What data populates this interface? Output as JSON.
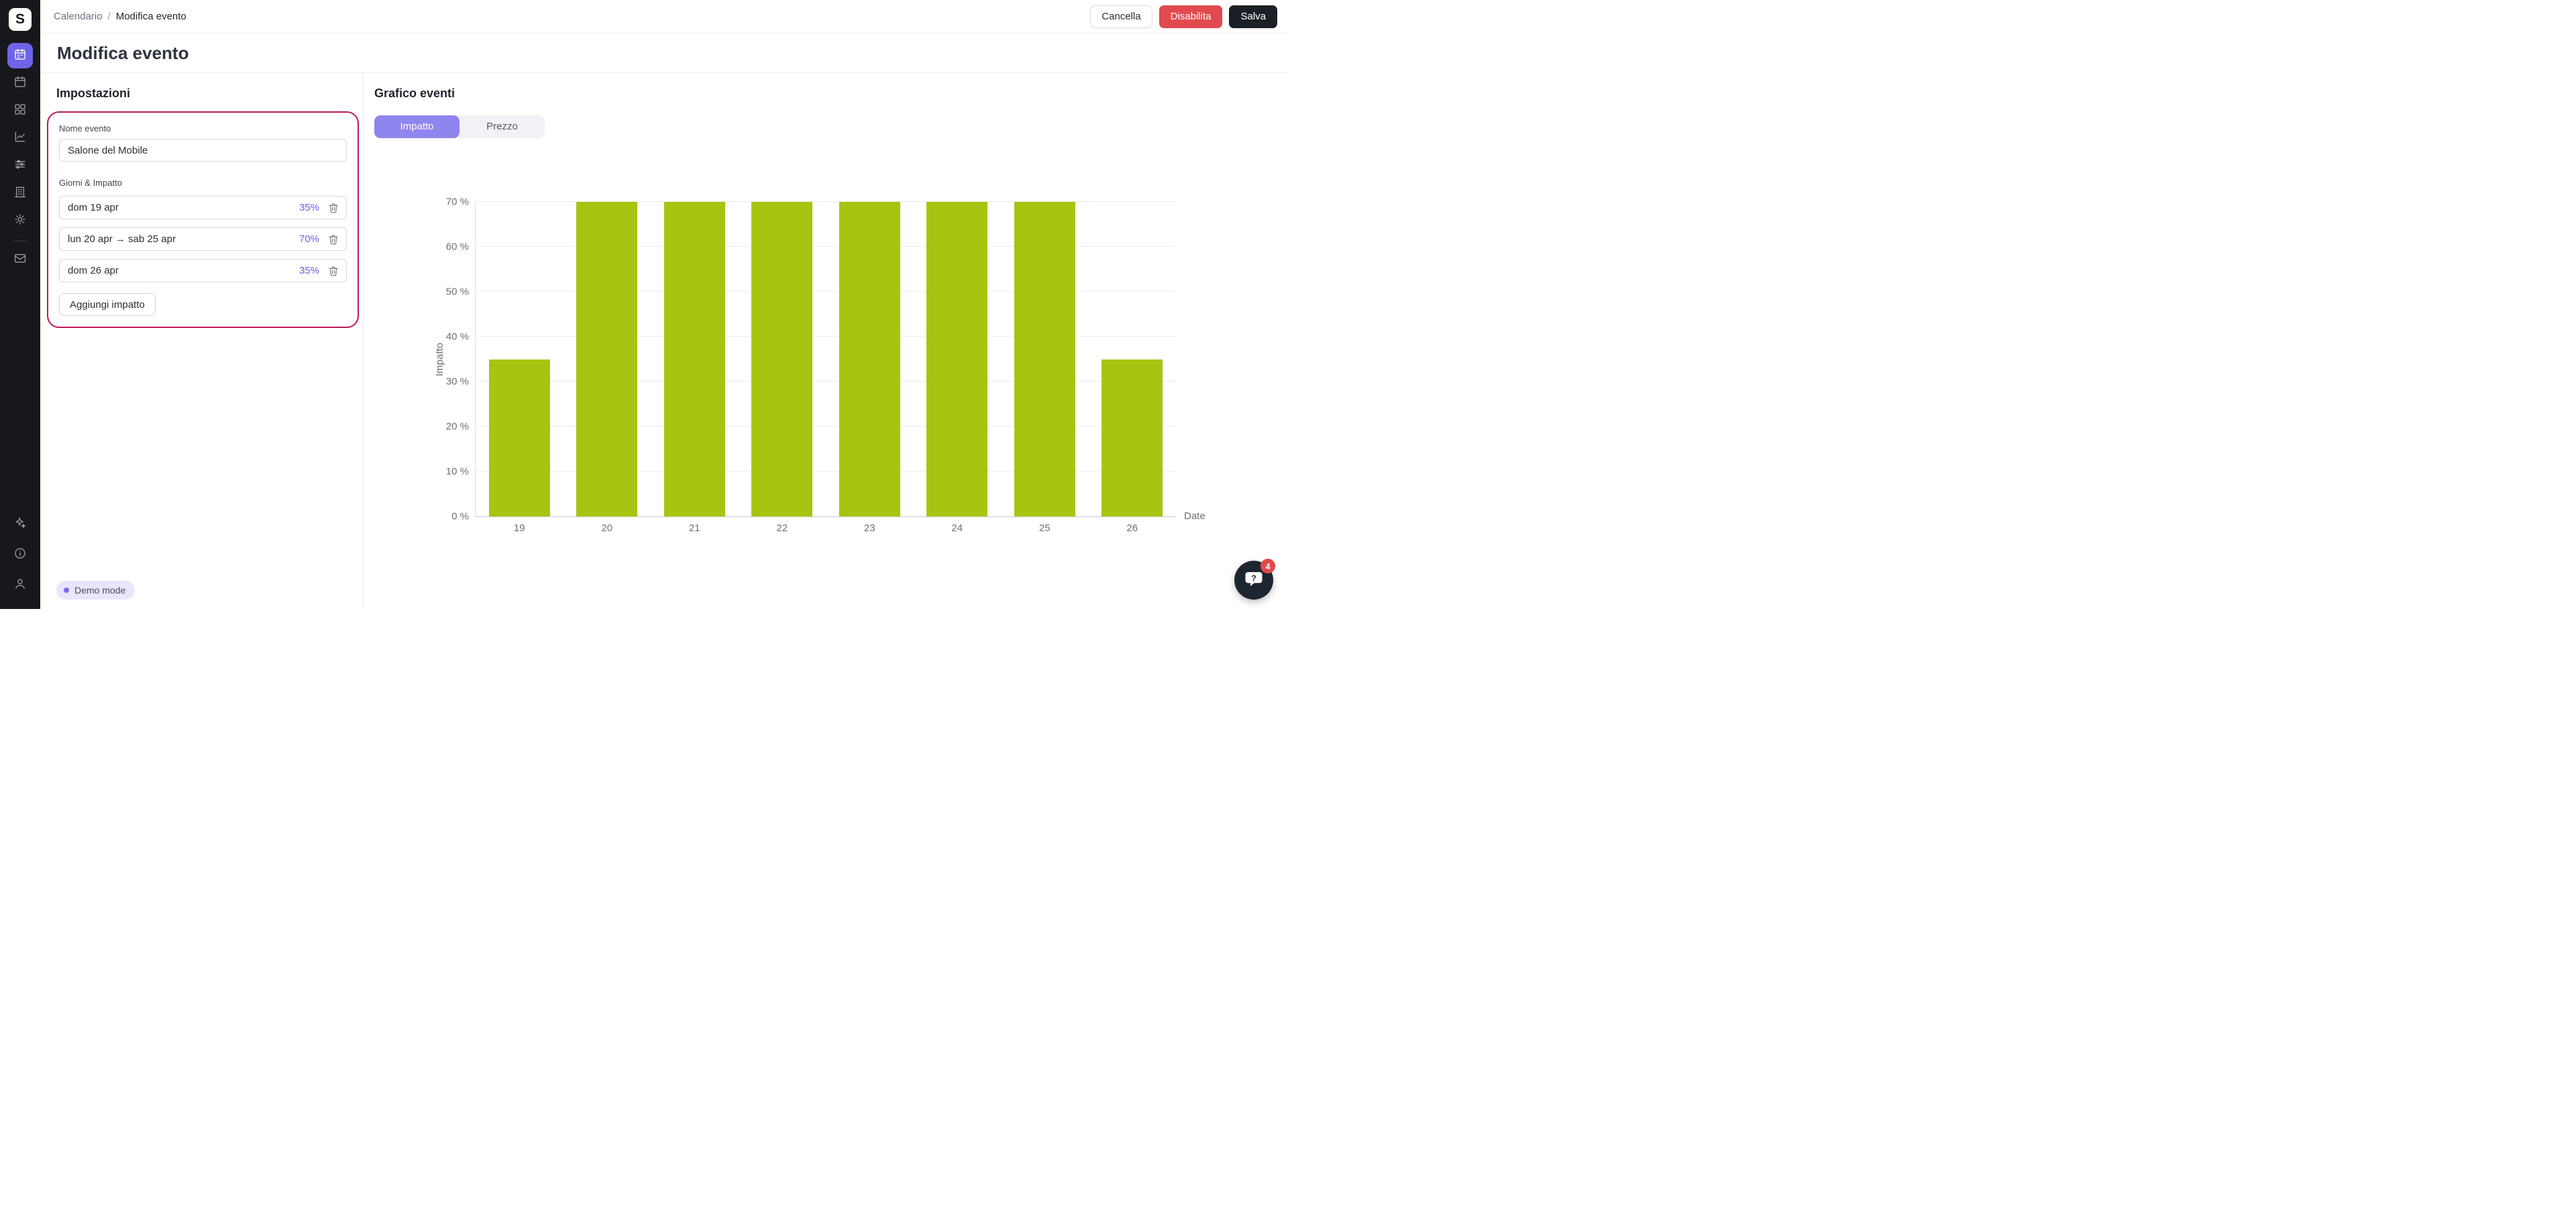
{
  "sidebar": {
    "logo_letter": "S",
    "items": [
      {
        "icon": "calendar-events-icon",
        "active": true
      },
      {
        "icon": "calendar-icon",
        "active": false
      },
      {
        "icon": "apps-grid-icon",
        "active": false
      },
      {
        "icon": "chart-line-icon",
        "active": false
      },
      {
        "icon": "sliders-icon",
        "active": false
      },
      {
        "icon": "building-icon",
        "active": false
      },
      {
        "icon": "settings-gear-icon",
        "active": false
      },
      {
        "icon": "mail-icon",
        "active": false
      }
    ],
    "bottom_items": [
      {
        "icon": "sparkles-icon"
      },
      {
        "icon": "info-icon"
      },
      {
        "icon": "user-icon"
      }
    ]
  },
  "header": {
    "breadcrumb": {
      "parent": "Calendario",
      "separator": "/",
      "current": "Modifica evento"
    },
    "buttons": {
      "cancel": "Cancella",
      "disable": "Disabilita",
      "save": "Salva"
    }
  },
  "page": {
    "title": "Modifica evento"
  },
  "settings": {
    "heading": "Impostazioni",
    "name_label": "Nome evento",
    "name_value": "Salone del Mobile",
    "days_label": "Giorni & Impatto",
    "rows": [
      {
        "label": "dom 19 apr",
        "impact": "35%"
      },
      {
        "label": "lun 20 apr → sab 25 apr",
        "impact": "70%"
      },
      {
        "label": "dom 26 apr",
        "impact": "35%"
      }
    ],
    "add_button": "Aggiungi impatto"
  },
  "chart_panel": {
    "heading": "Grafico eventi",
    "tabs": [
      {
        "label": "Impatto",
        "active": true
      },
      {
        "label": "Prezzo",
        "active": false
      }
    ]
  },
  "chart_data": {
    "type": "bar",
    "categories": [
      "19",
      "20",
      "21",
      "22",
      "23",
      "24",
      "25",
      "26"
    ],
    "values": [
      35,
      70,
      70,
      70,
      70,
      70,
      70,
      35
    ],
    "xlabel": "Date",
    "ylabel": "Impatto",
    "ylim": [
      0,
      70
    ],
    "yticks": [
      0,
      10,
      20,
      30,
      40,
      50,
      60,
      70
    ],
    "ytick_suffix": " %",
    "bar_color": "#a6c510",
    "grid": true,
    "legend": "none"
  },
  "footer": {
    "demo_badge": "Demo mode"
  },
  "help": {
    "badge_count": "4"
  },
  "colors": {
    "accent_purple": "#6f63e8",
    "highlight_border": "#bc1a5e",
    "bar_green": "#a6c510",
    "danger_red": "#e14a4e",
    "dark_button": "#1c1f26"
  }
}
